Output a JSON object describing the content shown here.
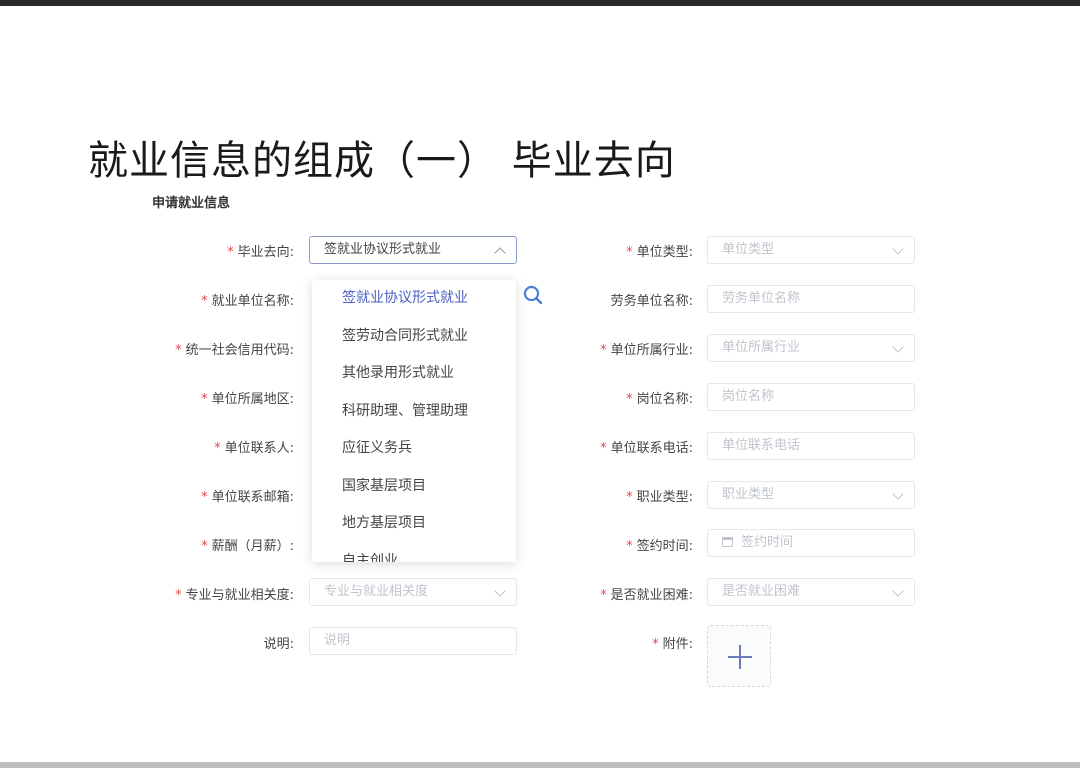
{
  "slide_title": "就业信息的组成（一）  毕业去向",
  "section_title": "申请就业信息",
  "left_fields": [
    {
      "label": "毕业去向:",
      "required": "*",
      "value": "签就业协议形式就业"
    },
    {
      "label": "就业单位名称:",
      "required": "*"
    },
    {
      "label": "统一社会信用代码:",
      "required": "*"
    },
    {
      "label": "单位所属地区:",
      "required": "*"
    },
    {
      "label": "单位联系人:",
      "required": "*"
    },
    {
      "label": "单位联系邮箱:",
      "required": "*"
    },
    {
      "label": "薪酬（月薪）:",
      "required": "*"
    },
    {
      "label": "专业与就业相关度:",
      "required": "*",
      "placeholder": "专业与就业相关度"
    },
    {
      "label": "说明:",
      "required": "",
      "placeholder": "说明"
    }
  ],
  "right_fields": [
    {
      "label": "单位类型:",
      "required": "*",
      "placeholder": "单位类型"
    },
    {
      "label": "劳务单位名称:",
      "required": "",
      "placeholder": "劳务单位名称"
    },
    {
      "label": "单位所属行业:",
      "required": "*",
      "placeholder": "单位所属行业"
    },
    {
      "label": "岗位名称:",
      "required": "*",
      "placeholder": "岗位名称"
    },
    {
      "label": "单位联系电话:",
      "required": "*",
      "placeholder": "单位联系电话"
    },
    {
      "label": "职业类型:",
      "required": "*",
      "placeholder": "职业类型"
    },
    {
      "label": "签约时间:",
      "required": "*",
      "placeholder": "签约时间"
    },
    {
      "label": "是否就业困难:",
      "required": "*",
      "placeholder": "是否就业困难"
    },
    {
      "label": "附件:",
      "required": "*"
    }
  ],
  "dropdown_options": [
    "签就业协议形式就业",
    "签劳动合同形式就业",
    "其他录用形式就业",
    "科研助理、管理助理",
    "应征义务兵",
    "国家基层项目",
    "地方基层项目",
    "自主创业"
  ],
  "colors": {
    "accent": "#4a5fc1",
    "required": "#e5484d",
    "placeholder": "#c0c4cc"
  }
}
